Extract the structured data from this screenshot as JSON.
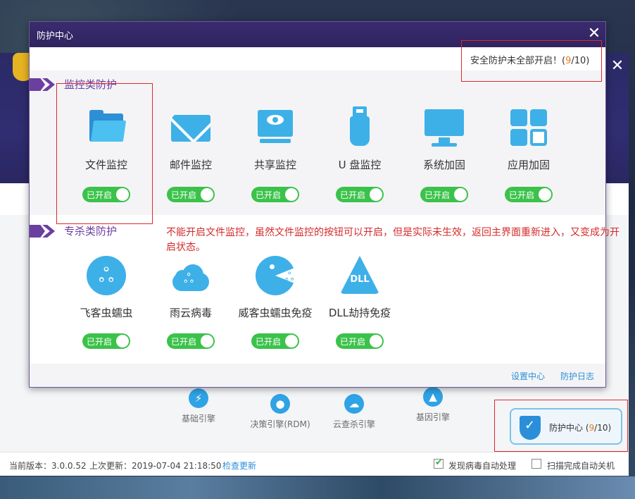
{
  "main": {
    "engines": [
      {
        "label": "基础引擎",
        "icon": "lightning-icon"
      },
      {
        "label": "决策引擎(RDM)",
        "icon": "user-icon"
      },
      {
        "label": "云查杀引擎",
        "icon": "cloud-icon"
      },
      {
        "label": "基因引擎",
        "icon": "gene-icon"
      }
    ],
    "footer": {
      "version": "当前版本：3.0.0.52",
      "last_update": "上次更新：2019-07-04 21:18:50",
      "check_update": "检查更新",
      "auto_process": "发现病毒自动处理",
      "auto_process_checked": true,
      "auto_shutdown": "扫描完成自动关机",
      "auto_shutdown_checked": false
    },
    "protect_center_button": {
      "label": "防护中心",
      "count_open": "9",
      "count_total": "/10"
    }
  },
  "dialog": {
    "title": "防护中心",
    "status_text": "安全防护未全部开启！",
    "status_count_open": "9",
    "status_count_total": "/10",
    "sections": [
      {
        "title": "监控类防护",
        "items": [
          {
            "label": "文件监控",
            "icon": "folder-icon",
            "toggle": "已开启"
          },
          {
            "label": "邮件监控",
            "icon": "mail-icon",
            "toggle": "已开启"
          },
          {
            "label": "共享监控",
            "icon": "share-monitor-icon",
            "toggle": "已开启"
          },
          {
            "label": "U 盘监控",
            "icon": "usb-icon",
            "toggle": "已开启"
          },
          {
            "label": "系统加固",
            "icon": "monitor-icon",
            "toggle": "已开启"
          },
          {
            "label": "应用加固",
            "icon": "app-tiles-icon",
            "toggle": "已开启"
          }
        ]
      },
      {
        "title": "专杀类防护",
        "items": [
          {
            "label": "飞客虫蠕虫",
            "icon": "worm-icon",
            "toggle": "已开启"
          },
          {
            "label": "雨云病毒",
            "icon": "cloud-virus-icon",
            "toggle": "已开启"
          },
          {
            "label": "威客虫蠕虫免疫",
            "icon": "pacman-icon",
            "toggle": "已开启"
          },
          {
            "label": "DLL劫持免疫",
            "icon": "dll-icon",
            "toggle": "已开启"
          }
        ]
      }
    ],
    "annotation": "不能开启文件监控，虽然文件监控的按钮可以开启，但是实际未生效，返回主界面重新进入，又变成为开启状态。",
    "footer_links": [
      "设置中心",
      "防护日志"
    ]
  },
  "colors": {
    "accent_purple": "#6b3fa0",
    "toggle_green": "#3bc24a",
    "icon_blue": "#3eb0e8",
    "annotation_red": "#d42b2b",
    "count_orange": "#e87a1e"
  }
}
